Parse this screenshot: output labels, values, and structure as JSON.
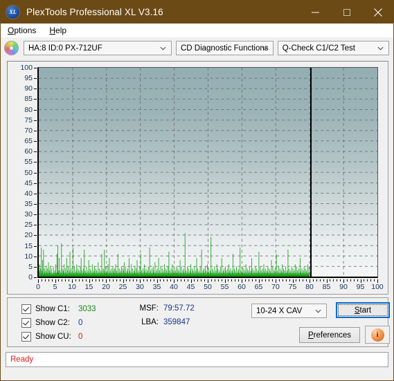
{
  "window": {
    "title": "PlexTools Professional XL V3.16",
    "app_icon": "xl-logo-icon",
    "minimize": "minimize-icon",
    "maximize": "maximize-icon",
    "close": "close-icon",
    "titlebar_color": "#6b4a16"
  },
  "menu": {
    "items": [
      {
        "label": "Options"
      },
      {
        "label": "Help"
      }
    ]
  },
  "toolbar": {
    "disc_icon": "cd-disc-icon",
    "drive_select": "HA:8 ID:0  PX-712UF",
    "function_select": "CD Diagnostic Functions",
    "test_select": "Q-Check C1/C2 Test"
  },
  "chart_data": {
    "type": "bar",
    "title": "",
    "xlabel": "",
    "ylabel": "",
    "xlim": [
      0,
      100
    ],
    "ylim": [
      0,
      100
    ],
    "xticks": [
      0,
      5,
      10,
      15,
      20,
      25,
      30,
      35,
      40,
      45,
      50,
      55,
      60,
      65,
      70,
      75,
      80,
      85,
      90,
      95,
      100
    ],
    "yticks": [
      0,
      5,
      10,
      15,
      20,
      25,
      30,
      35,
      40,
      45,
      50,
      55,
      60,
      65,
      70,
      75,
      80,
      85,
      90,
      95,
      100
    ],
    "grid": true,
    "legend_position": "none",
    "series": [
      {
        "name": "C1",
        "color": "#18a018",
        "data_end_x": 80,
        "max_value": 21,
        "values": [
          3,
          6,
          2,
          4,
          1,
          14,
          3,
          2,
          8,
          1,
          13,
          2,
          4,
          2,
          1,
          3,
          5,
          2,
          1,
          4,
          2,
          7,
          1,
          3,
          2,
          5,
          1,
          2,
          4,
          1,
          2,
          1,
          5,
          2,
          1,
          3,
          2,
          6,
          1,
          2,
          11,
          2,
          15,
          3,
          2,
          9,
          1,
          3,
          2,
          1,
          16,
          2,
          4,
          1,
          3,
          2,
          6,
          1,
          2,
          4,
          1,
          2,
          9,
          3,
          1,
          5,
          2,
          1,
          3,
          12,
          2,
          1,
          4,
          2,
          1,
          3,
          14,
          2,
          1,
          5,
          2,
          1,
          3,
          2,
          6,
          1,
          2,
          4,
          1,
          3,
          2,
          1,
          5,
          2,
          9,
          1,
          3,
          2,
          1,
          4,
          2,
          13,
          1,
          3,
          2,
          1,
          5,
          2,
          1,
          3,
          2,
          8,
          1,
          2,
          4,
          1,
          3,
          2,
          1,
          6,
          2,
          1,
          3,
          2,
          5,
          1,
          2,
          4,
          1,
          3,
          2,
          1,
          7,
          2,
          1,
          4,
          2,
          1,
          3,
          2,
          11,
          1,
          2,
          4,
          1,
          3,
          13,
          2,
          1,
          5,
          2,
          1,
          3,
          2,
          6,
          1,
          2,
          9,
          1,
          3,
          2,
          1,
          4,
          2,
          1,
          5,
          3,
          2,
          1,
          4,
          2,
          6,
          1,
          3,
          2,
          1,
          11,
          2,
          1,
          4,
          2,
          1,
          3,
          2,
          5,
          1,
          2,
          4,
          1,
          3,
          7,
          2,
          1,
          5,
          2,
          1,
          3,
          2,
          4,
          1,
          2,
          9,
          1,
          3,
          2,
          1,
          6,
          2,
          1,
          4,
          2,
          1,
          3,
          2,
          5,
          1,
          2,
          4,
          1,
          8,
          2,
          1,
          3,
          2,
          1,
          5,
          2,
          11,
          1,
          3,
          2,
          1,
          4,
          2,
          1,
          6,
          3,
          2,
          1,
          4,
          2,
          1,
          3,
          2,
          5,
          1,
          2,
          14,
          1,
          3,
          2,
          1,
          4,
          2,
          1,
          5,
          3,
          2,
          1,
          7,
          2,
          1,
          3,
          2,
          4,
          1,
          2,
          9,
          1,
          3,
          2,
          1,
          5,
          2,
          1,
          4,
          2,
          1,
          3,
          2,
          6,
          1,
          2,
          4,
          1,
          3,
          2,
          1,
          5,
          2,
          12,
          1,
          3,
          2,
          1,
          4,
          2,
          1,
          6,
          3,
          2,
          1,
          4,
          2,
          1,
          3,
          2,
          5,
          1,
          2,
          4,
          1,
          3,
          2,
          1,
          8,
          2,
          1,
          5,
          2,
          1,
          3,
          2,
          4,
          1,
          2,
          21,
          1,
          3,
          2,
          1,
          5,
          2,
          1,
          4,
          2,
          1,
          3,
          2,
          6,
          1,
          2,
          4,
          1,
          3,
          2,
          1,
          5,
          2,
          1,
          3,
          2,
          9,
          1,
          4,
          2,
          1,
          3,
          2,
          1,
          5,
          2,
          1,
          13,
          2,
          1,
          3,
          2,
          4,
          1,
          2,
          5,
          1,
          3,
          2,
          1,
          6,
          2,
          1,
          4,
          2,
          1,
          3,
          2,
          19,
          1,
          2,
          4,
          1,
          3,
          2,
          1,
          5,
          2,
          1,
          3,
          2,
          6,
          1,
          4,
          2,
          1,
          3,
          2,
          1,
          5,
          2,
          1,
          9,
          2,
          1,
          3,
          2,
          4,
          1,
          2,
          5,
          1,
          3,
          2,
          1,
          4,
          2,
          1,
          6,
          3,
          2,
          1,
          4,
          2,
          1,
          3,
          2,
          11,
          1,
          2,
          4,
          1,
          3,
          2,
          1,
          5,
          2,
          1,
          3,
          2,
          4,
          1,
          2,
          14,
          1,
          3,
          2,
          1,
          5,
          2,
          1,
          4,
          2,
          1,
          3,
          2,
          6,
          1,
          2,
          4,
          1,
          3,
          2,
          1,
          5,
          2,
          1,
          3,
          2,
          9,
          1,
          4,
          2,
          1,
          3,
          2,
          1,
          5,
          2,
          1,
          4,
          2,
          1,
          3,
          2,
          12,
          1,
          2,
          5,
          1,
          3,
          2,
          1,
          4,
          2,
          1,
          6,
          3,
          2,
          1,
          4,
          2,
          1,
          3,
          2,
          5,
          1,
          2,
          4,
          1,
          3,
          2,
          1,
          8,
          2,
          1,
          5,
          2,
          1,
          3,
          2,
          4,
          1,
          2,
          11,
          1,
          3,
          2,
          1,
          5,
          2,
          1,
          4,
          2,
          1,
          3,
          2,
          6,
          1,
          2,
          4,
          1,
          3,
          2,
          1,
          5,
          2,
          1,
          3,
          2,
          13,
          1,
          4,
          2,
          1,
          3,
          2,
          1,
          5,
          2,
          1,
          4,
          2,
          1,
          3,
          2,
          6,
          1,
          2,
          5,
          1,
          3,
          2,
          1,
          4,
          2,
          1,
          9,
          3,
          2,
          1,
          4,
          2,
          1,
          3,
          2,
          5,
          1,
          2,
          4,
          1,
          3,
          2,
          1,
          6,
          2,
          1,
          5,
          2
        ]
      },
      {
        "name": "C2",
        "color": "#1630c8",
        "data_end_x": 80,
        "max_value": 0,
        "values": []
      }
    ]
  },
  "chart_style": {
    "plot_bg_top": "#93aeb3",
    "plot_bg_bottom": "#f5f7f7",
    "grid_color": "#6e6e6e",
    "axis_color": "#000000",
    "tick_label_color": "#16335c",
    "end_marker_x": 80
  },
  "controls": {
    "checkboxes": [
      {
        "label": "Show C1:",
        "value": "3033",
        "checked": true,
        "color": "#1a8a1a"
      },
      {
        "label": "Show C2:",
        "value": "0",
        "checked": true,
        "color": "#1630c8"
      },
      {
        "label": "Show CU:",
        "value": "0",
        "checked": true,
        "color": "#d21414"
      }
    ],
    "msf_label": "MSF:",
    "msf_value": "79:57.72",
    "lba_label": "LBA:",
    "lba_value": "359847",
    "speed_select": "10-24 X CAV",
    "start_button": "Start",
    "preferences_button": "Preferences",
    "info_button": "info-icon"
  },
  "status": {
    "text": "Ready",
    "color": "#e02020"
  }
}
